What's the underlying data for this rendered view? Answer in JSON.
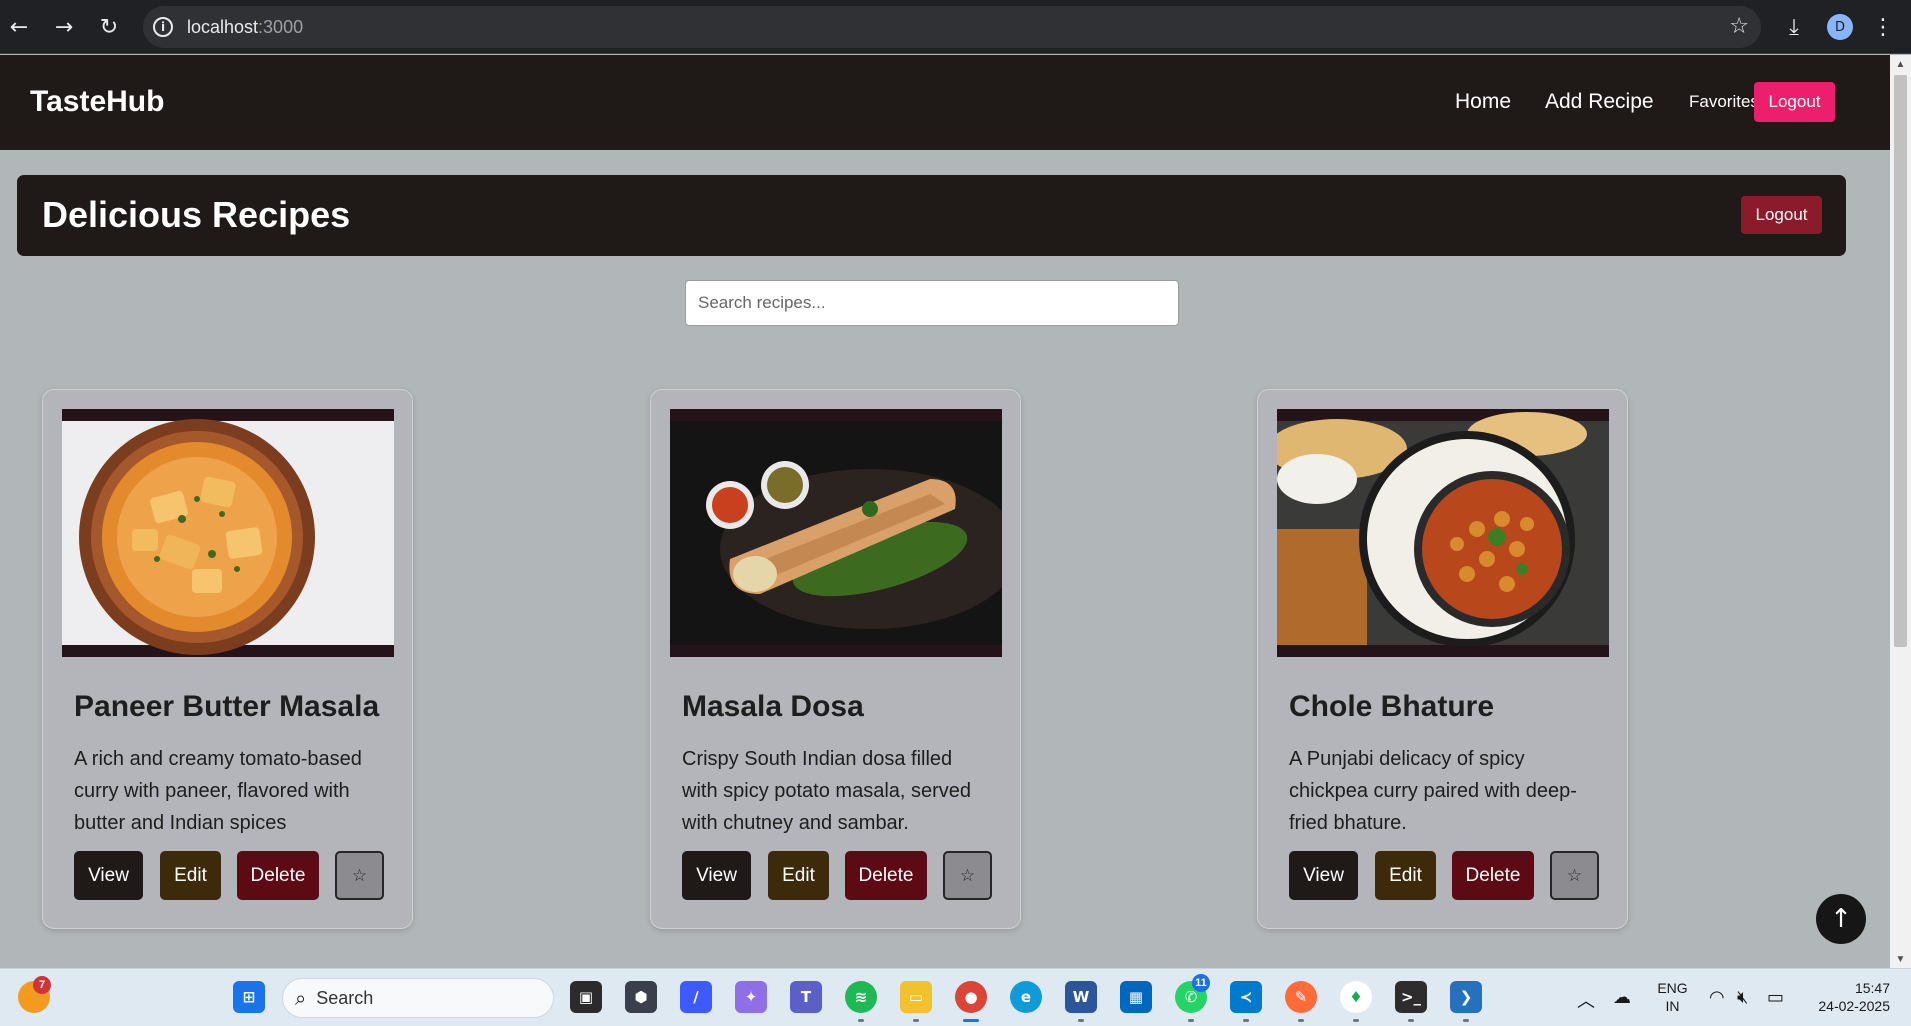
{
  "browser": {
    "back_icon": "arrow-left-icon",
    "forward_icon": "arrow-right-icon",
    "reload_icon": "reload-icon",
    "url_host": "localhost",
    "url_port": ":3000",
    "profile_initial": "D"
  },
  "navbar": {
    "brand": "TasteHub",
    "links": [
      "Home",
      "Add Recipe"
    ],
    "favorites": "Favorites",
    "logout": "Logout"
  },
  "hero": {
    "title": "Delicious Recipes",
    "logout": "Logout"
  },
  "search": {
    "placeholder": "Search recipes..."
  },
  "recipes": [
    {
      "title": "Paneer Butter Masala",
      "description": "A rich and creamy tomato-based curry with paneer, flavored with butter and Indian spices",
      "view": "View",
      "edit": "Edit",
      "delete": "Delete",
      "favorite": "☆"
    },
    {
      "title": "Masala Dosa",
      "description": "Crispy South Indian dosa filled with spicy potato masala, served with chutney and sambar.",
      "view": "View",
      "edit": "Edit",
      "delete": "Delete",
      "favorite": "☆"
    },
    {
      "title": "Chole Bhature",
      "description": "A Punjabi delicacy of spicy chickpea curry paired with deep-fried bhature.",
      "view": "View",
      "edit": "Edit",
      "delete": "Delete",
      "favorite": "☆"
    }
  ],
  "scroll_top": "↑",
  "taskbar": {
    "weather_badge": "7",
    "search": "Search",
    "whatsapp_badge": "11",
    "language": "ENG",
    "region": "IN",
    "time": "15:47",
    "date": "24-02-2025"
  },
  "colors": {
    "page_bg": "#b1b6b8",
    "navbar_bg": "#1f1a17",
    "accent_logout": "#ed1e6b",
    "hero_logout": "#8b1a2b"
  }
}
